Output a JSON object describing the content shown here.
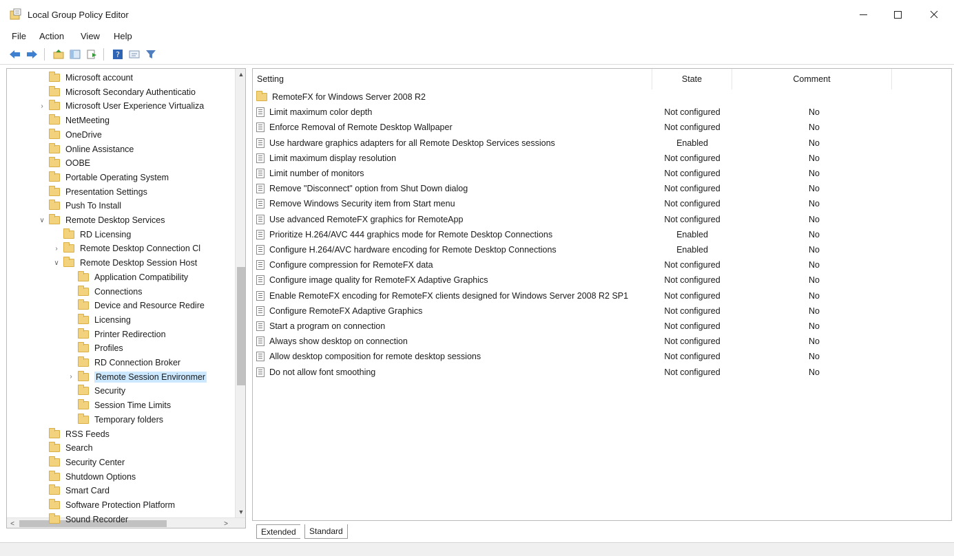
{
  "window": {
    "title": "Local Group Policy Editor"
  },
  "menu": [
    "File",
    "Action",
    "View",
    "Help"
  ],
  "toolbar": {
    "icons": [
      "back-arrow-icon",
      "forward-arrow-icon",
      "up-folder-icon",
      "show-hide-tree-icon",
      "export-list-icon",
      "help-icon",
      "properties-icon",
      "filter-icon"
    ]
  },
  "tree": {
    "items": [
      {
        "label": "Microsoft account",
        "level": 0,
        "expander": ""
      },
      {
        "label": "Microsoft Secondary Authenticatio",
        "level": 0,
        "expander": ""
      },
      {
        "label": "Microsoft User Experience Virtualiza",
        "level": 0,
        "expander": ">"
      },
      {
        "label": "NetMeeting",
        "level": 0,
        "expander": ""
      },
      {
        "label": "OneDrive",
        "level": 0,
        "expander": ""
      },
      {
        "label": "Online Assistance",
        "level": 0,
        "expander": ""
      },
      {
        "label": "OOBE",
        "level": 0,
        "expander": ""
      },
      {
        "label": "Portable Operating System",
        "level": 0,
        "expander": ""
      },
      {
        "label": "Presentation Settings",
        "level": 0,
        "expander": ""
      },
      {
        "label": "Push To Install",
        "level": 0,
        "expander": ""
      },
      {
        "label": "Remote Desktop Services",
        "level": 0,
        "expander": "v"
      },
      {
        "label": "RD Licensing",
        "level": 1,
        "expander": ""
      },
      {
        "label": "Remote Desktop Connection Cl",
        "level": 1,
        "expander": ">"
      },
      {
        "label": "Remote Desktop Session Host",
        "level": 1,
        "expander": "v"
      },
      {
        "label": "Application Compatibility",
        "level": 2,
        "expander": ""
      },
      {
        "label": "Connections",
        "level": 2,
        "expander": ""
      },
      {
        "label": "Device and Resource Redire",
        "level": 2,
        "expander": ""
      },
      {
        "label": "Licensing",
        "level": 2,
        "expander": ""
      },
      {
        "label": "Printer Redirection",
        "level": 2,
        "expander": ""
      },
      {
        "label": "Profiles",
        "level": 2,
        "expander": ""
      },
      {
        "label": "RD Connection Broker",
        "level": 2,
        "expander": ""
      },
      {
        "label": "Remote Session Environmer",
        "level": 2,
        "expander": ">",
        "selected": true
      },
      {
        "label": "Security",
        "level": 2,
        "expander": ""
      },
      {
        "label": "Session Time Limits",
        "level": 2,
        "expander": ""
      },
      {
        "label": "Temporary folders",
        "level": 2,
        "expander": ""
      },
      {
        "label": "RSS Feeds",
        "level": 0,
        "expander": ""
      },
      {
        "label": "Search",
        "level": 0,
        "expander": ""
      },
      {
        "label": "Security Center",
        "level": 0,
        "expander": ""
      },
      {
        "label": "Shutdown Options",
        "level": 0,
        "expander": ""
      },
      {
        "label": "Smart Card",
        "level": 0,
        "expander": ""
      },
      {
        "label": "Software Protection Platform",
        "level": 0,
        "expander": ""
      },
      {
        "label": "Sound Recorder",
        "level": 0,
        "expander": ""
      }
    ]
  },
  "settings": {
    "columns": {
      "setting": "Setting",
      "state": "State",
      "comment": "Comment"
    },
    "rows": [
      {
        "name": "RemoteFX for Windows Server 2008 R2",
        "state": "",
        "comment": "",
        "is_folder": true
      },
      {
        "name": "Limit maximum color depth",
        "state": "Not configured",
        "comment": "No"
      },
      {
        "name": "Enforce Removal of Remote Desktop Wallpaper",
        "state": "Not configured",
        "comment": "No"
      },
      {
        "name": "Use hardware graphics adapters for all Remote Desktop Services sessions",
        "state": "Enabled",
        "comment": "No"
      },
      {
        "name": "Limit maximum display resolution",
        "state": "Not configured",
        "comment": "No"
      },
      {
        "name": "Limit number of monitors",
        "state": "Not configured",
        "comment": "No"
      },
      {
        "name": "Remove \"Disconnect\" option from Shut Down dialog",
        "state": "Not configured",
        "comment": "No"
      },
      {
        "name": "Remove Windows Security item from Start menu",
        "state": "Not configured",
        "comment": "No"
      },
      {
        "name": "Use advanced RemoteFX graphics for RemoteApp",
        "state": "Not configured",
        "comment": "No"
      },
      {
        "name": "Prioritize H.264/AVC 444 graphics mode for Remote Desktop Connections",
        "state": "Enabled",
        "comment": "No"
      },
      {
        "name": "Configure H.264/AVC hardware encoding for Remote Desktop Connections",
        "state": "Enabled",
        "comment": "No"
      },
      {
        "name": "Configure compression for RemoteFX data",
        "state": "Not configured",
        "comment": "No"
      },
      {
        "name": "Configure image quality for RemoteFX Adaptive Graphics",
        "state": "Not configured",
        "comment": "No"
      },
      {
        "name": "Enable RemoteFX encoding for RemoteFX clients designed for Windows Server 2008 R2 SP1",
        "state": "Not configured",
        "comment": "No"
      },
      {
        "name": "Configure RemoteFX Adaptive Graphics",
        "state": "Not configured",
        "comment": "No"
      },
      {
        "name": "Start a program on connection",
        "state": "Not configured",
        "comment": "No"
      },
      {
        "name": "Always show desktop on connection",
        "state": "Not configured",
        "comment": "No"
      },
      {
        "name": "Allow desktop composition for remote desktop sessions",
        "state": "Not configured",
        "comment": "No"
      },
      {
        "name": "Do not allow font smoothing",
        "state": "Not configured",
        "comment": "No"
      }
    ]
  },
  "tabs": [
    {
      "label": "Extended",
      "active": false
    },
    {
      "label": "Standard",
      "active": true
    }
  ]
}
